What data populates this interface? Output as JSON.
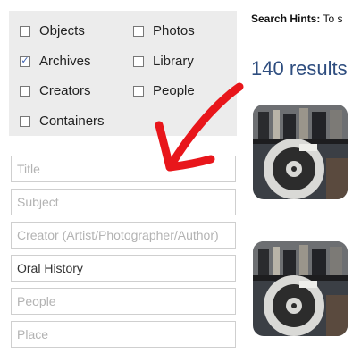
{
  "filters": {
    "objects": {
      "label": "Objects",
      "checked": false
    },
    "photos": {
      "label": "Photos",
      "checked": false
    },
    "archives": {
      "label": "Archives",
      "checked": true
    },
    "library": {
      "label": "Library",
      "checked": false
    },
    "creators": {
      "label": "Creators",
      "checked": false
    },
    "people": {
      "label": "People",
      "checked": false
    },
    "containers": {
      "label": "Containers",
      "checked": false
    }
  },
  "fields": {
    "title": {
      "placeholder": "Title",
      "value": ""
    },
    "subject": {
      "placeholder": "Subject",
      "value": ""
    },
    "creator": {
      "placeholder": "Creator (Artist/Photographer/Author)",
      "value": ""
    },
    "collection": {
      "placeholder": "",
      "value": "Oral History"
    },
    "people": {
      "placeholder": "People",
      "value": ""
    },
    "place": {
      "placeholder": "Place",
      "value": ""
    }
  },
  "hints": {
    "label": "Search Hints:",
    "text": "To s"
  },
  "results": {
    "count_label": "140 results"
  },
  "colors": {
    "accent": "#2e4d7f",
    "annotation_arrow": "#e8161b",
    "panel": "#ececec"
  },
  "icons": {
    "checkbox_checked": "✓"
  }
}
